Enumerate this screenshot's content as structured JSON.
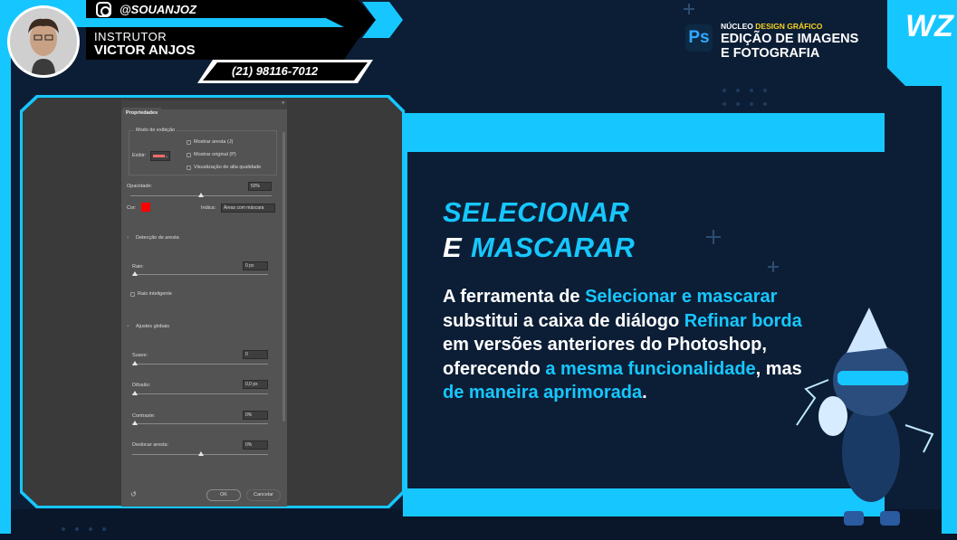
{
  "header": {
    "instagram_handle": "@SOUANJOZ",
    "instructor_label": "INSTRUTOR",
    "instructor_name": "VICTOR ANJOS",
    "phone": "(21) 98116-7012"
  },
  "course": {
    "app_icon": "Ps",
    "nucleo_prefix": "NÚCLEO",
    "nucleo_highlight": "DESIGN GRÁFICO",
    "title_line1": "EDIÇÃO DE IMAGENS",
    "title_line2": "E FOTOGRAFIA"
  },
  "brand_logo": "WZ",
  "colors": {
    "accent": "#16c7ff",
    "background": "#0c1e36",
    "highlight_yellow": "#f7d21e",
    "panel_gray": "#535353",
    "mask_color": "#ff0000"
  },
  "ps_panel": {
    "tab": "Propriedades",
    "view_mode_group": "Modo de exibição",
    "show_label": "Exibir:",
    "options": [
      "Mostrar aresta (J)",
      "Mostrar original (P)",
      "Visualização de alta qualidade"
    ],
    "opacity_label": "Opacidade:",
    "opacity_value": "50%",
    "color_label": "Cor:",
    "indicates_label": "Indica:",
    "indicates_value": "Áreas com máscara",
    "edge_detection": "Detecção de aresta",
    "radius_label": "Raio:",
    "radius_value": "0 px",
    "smart_radius": "Raio inteligente",
    "global_adjust": "Ajustes globais",
    "smooth_label": "Suave:",
    "smooth_value": "0",
    "feather_label": "Difusão:",
    "feather_value": "0,0 px",
    "contrast_label": "Contraste:",
    "contrast_value": "0%",
    "shift_edge_label": "Deslocar aresta:",
    "shift_edge_value": "0%",
    "ok_button": "OK",
    "cancel_button": "Cancelar"
  },
  "content": {
    "title_line1": "SELECIONAR",
    "title_line2_a": "E",
    "title_line2_b": "MASCARAR",
    "desc": [
      {
        "t": "A ferramenta de ",
        "hl": false
      },
      {
        "t": "Selecionar e mascarar",
        "hl": true
      },
      {
        "t": " substitui a caixa de diálogo ",
        "hl": false
      },
      {
        "t": "Refinar borda",
        "hl": true
      },
      {
        "t": " em versões anteriores do Photoshop, oferecendo ",
        "hl": false
      },
      {
        "t": "a mesma funcionalidade",
        "hl": true
      },
      {
        "t": ", mas ",
        "hl": false
      },
      {
        "t": "de maneira aprimorada",
        "hl": true
      },
      {
        "t": ".",
        "hl": false
      }
    ]
  }
}
